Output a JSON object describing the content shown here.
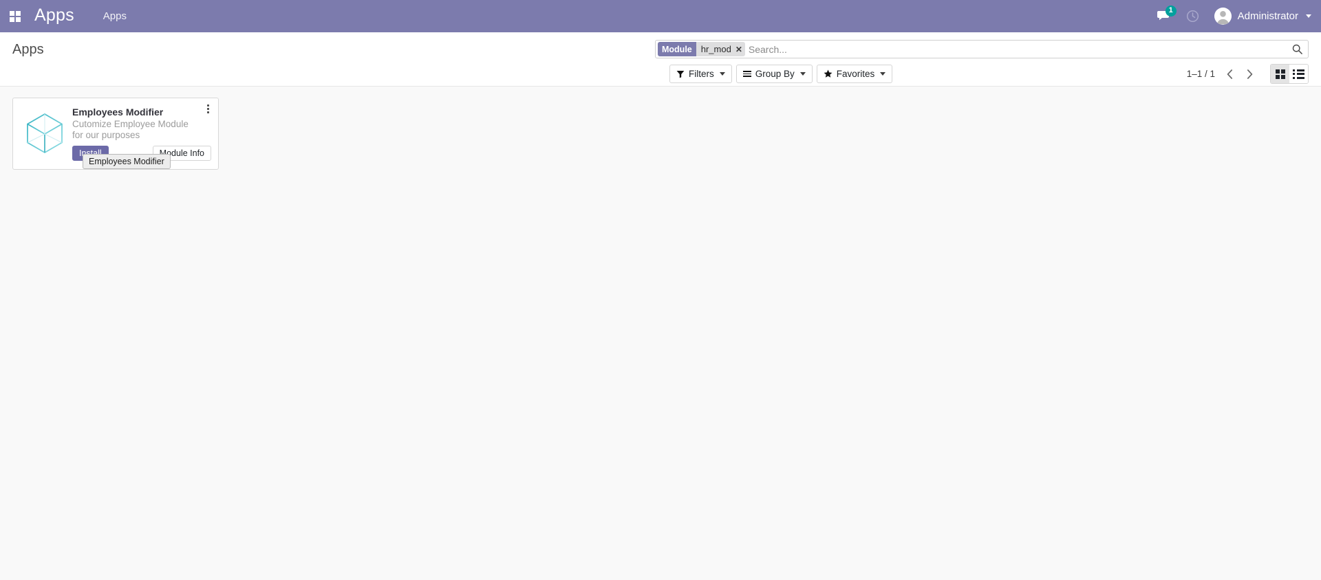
{
  "navbar": {
    "apps_menu_icon": "grid-apps-icon",
    "brand": "Apps",
    "breadcrumb": "Apps",
    "messages_icon": "messages-icon",
    "messages_count": "1",
    "activities_icon": "clock-activity-icon",
    "avatar_icon": "user-avatar-icon",
    "username": "Administrator",
    "background_color": "#7c7bad",
    "badge_color": "#00a09d"
  },
  "control_panel": {
    "page_title": "Apps",
    "search": {
      "facet_label": "Module",
      "facet_value": "hr_mod",
      "facet_close_icon": "close-icon",
      "placeholder": "Search...",
      "value": "",
      "search_icon": "search-icon"
    },
    "buttons": [
      {
        "label": "Filters",
        "icon": "filter-funnel-icon"
      },
      {
        "label": "Group By",
        "icon": "group-by-lines-icon"
      },
      {
        "label": "Favorites",
        "icon": "star-icon"
      }
    ],
    "pager": {
      "count": "1–1 / 1",
      "prev_icon": "chevron-left-icon",
      "next_icon": "chevron-right-icon"
    },
    "view_switcher": {
      "grid_icon": "grid-view-icon",
      "list_icon": "list-view-icon",
      "active": "grid"
    }
  },
  "apps": [
    {
      "icon": "module-cube-icon",
      "title": "Employees Modifier",
      "description": "Cutomize Employee Module for our purposes",
      "install_label": "Install",
      "module_info_label": "Module Info",
      "kebab_icon": "vertical-dots-icon",
      "install_color": "#6c6aa8"
    }
  ],
  "tooltip": {
    "text": "Employees Modifier"
  }
}
